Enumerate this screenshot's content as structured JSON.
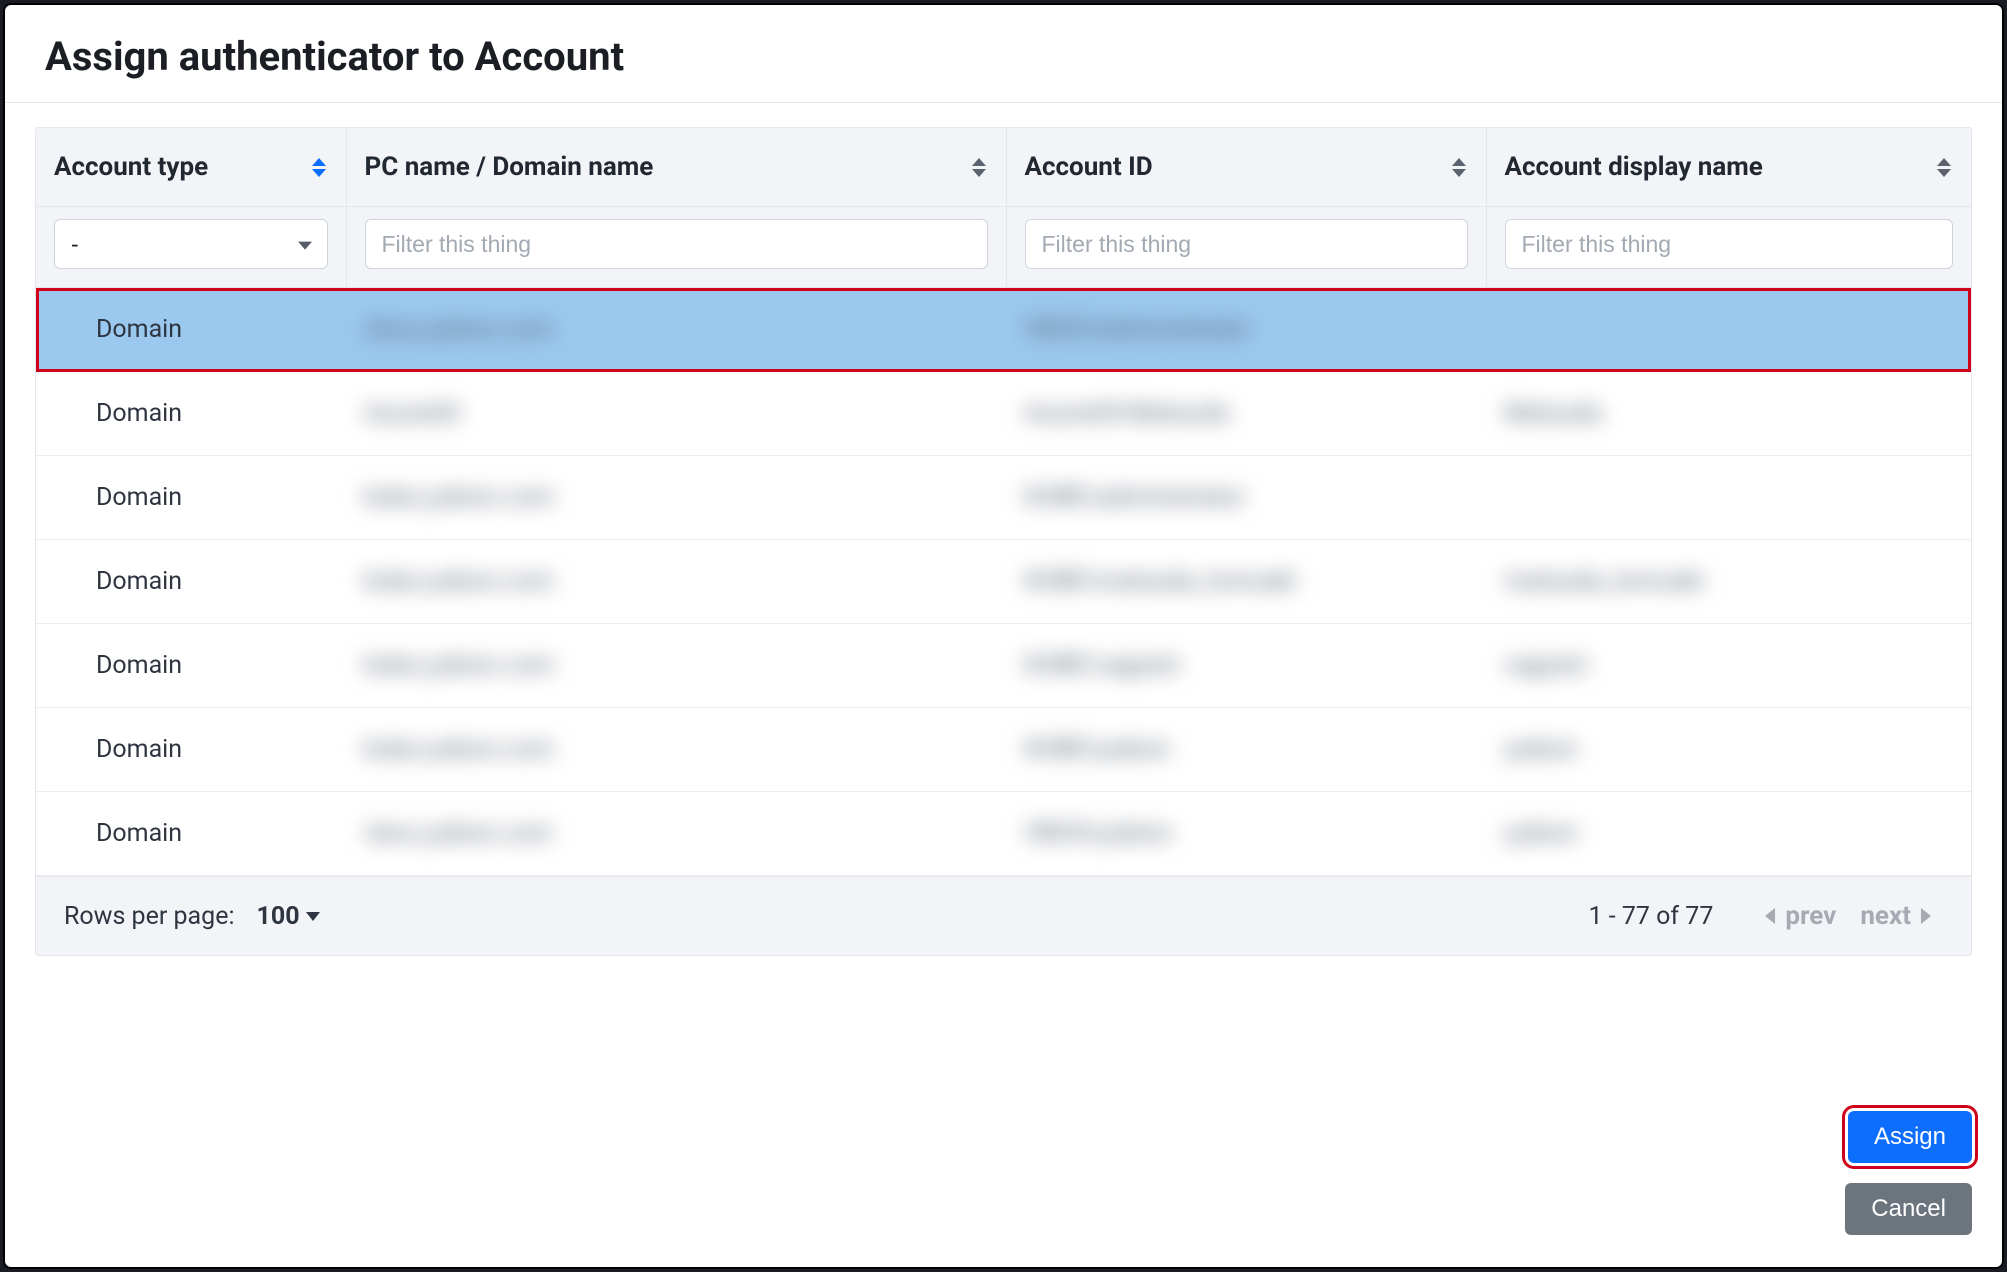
{
  "modal": {
    "title": "Assign authenticator to Account"
  },
  "table": {
    "columns": {
      "type": "Account type",
      "pc": "PC name / Domain name",
      "id": "Account ID",
      "disp": "Account display name"
    },
    "filter_placeholder": "Filter this thing",
    "type_filter_value": "-",
    "rows": [
      {
        "type": "Domain",
        "pc": "vbox.yubion.com",
        "id": "VBOX\\Administrator",
        "disp": "",
        "selected": true
      },
      {
        "type": "Domain",
        "pc": "AzureAD",
        "id": "AzureAD\\Matsuda",
        "disp": "Matsuda"
      },
      {
        "type": "Domain",
        "pc": "kobe.yubion.com",
        "id": "KOBE\\administrator",
        "disp": ""
      },
      {
        "type": "Domain",
        "pc": "kobe.yubion.com",
        "id": "KOBE\\matsuda_tomoaki",
        "disp": "matsuda_tomoaki"
      },
      {
        "type": "Domain",
        "pc": "kobe.yubion.com",
        "id": "KOBE\\vagrant",
        "disp": "vagrant"
      },
      {
        "type": "Domain",
        "pc": "kobe.yubion.com",
        "id": "KOBE\\yubion",
        "disp": "yubion"
      },
      {
        "type": "Domain",
        "pc": "vbox.yubion.com",
        "id": "VBOX\\yubion",
        "disp": "yubion"
      }
    ]
  },
  "pagination": {
    "rows_per_page_label": "Rows per page:",
    "rows_per_page_value": "100",
    "info": "1 - 77 of 77",
    "prev": "prev",
    "next": "next"
  },
  "buttons": {
    "assign": "Assign",
    "cancel": "Cancel"
  }
}
